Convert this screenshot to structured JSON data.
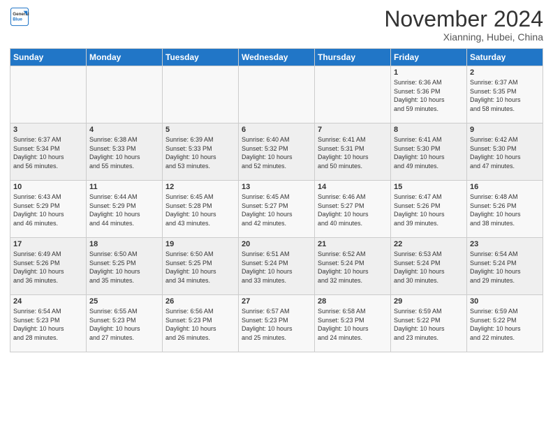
{
  "header": {
    "logo_line1": "General",
    "logo_line2": "Blue",
    "month_title": "November 2024",
    "location": "Xianning, Hubei, China"
  },
  "weekdays": [
    "Sunday",
    "Monday",
    "Tuesday",
    "Wednesday",
    "Thursday",
    "Friday",
    "Saturday"
  ],
  "weeks": [
    [
      {
        "day": "",
        "info": ""
      },
      {
        "day": "",
        "info": ""
      },
      {
        "day": "",
        "info": ""
      },
      {
        "day": "",
        "info": ""
      },
      {
        "day": "",
        "info": ""
      },
      {
        "day": "1",
        "info": "Sunrise: 6:36 AM\nSunset: 5:36 PM\nDaylight: 10 hours\nand 59 minutes."
      },
      {
        "day": "2",
        "info": "Sunrise: 6:37 AM\nSunset: 5:35 PM\nDaylight: 10 hours\nand 58 minutes."
      }
    ],
    [
      {
        "day": "3",
        "info": "Sunrise: 6:37 AM\nSunset: 5:34 PM\nDaylight: 10 hours\nand 56 minutes."
      },
      {
        "day": "4",
        "info": "Sunrise: 6:38 AM\nSunset: 5:33 PM\nDaylight: 10 hours\nand 55 minutes."
      },
      {
        "day": "5",
        "info": "Sunrise: 6:39 AM\nSunset: 5:33 PM\nDaylight: 10 hours\nand 53 minutes."
      },
      {
        "day": "6",
        "info": "Sunrise: 6:40 AM\nSunset: 5:32 PM\nDaylight: 10 hours\nand 52 minutes."
      },
      {
        "day": "7",
        "info": "Sunrise: 6:41 AM\nSunset: 5:31 PM\nDaylight: 10 hours\nand 50 minutes."
      },
      {
        "day": "8",
        "info": "Sunrise: 6:41 AM\nSunset: 5:30 PM\nDaylight: 10 hours\nand 49 minutes."
      },
      {
        "day": "9",
        "info": "Sunrise: 6:42 AM\nSunset: 5:30 PM\nDaylight: 10 hours\nand 47 minutes."
      }
    ],
    [
      {
        "day": "10",
        "info": "Sunrise: 6:43 AM\nSunset: 5:29 PM\nDaylight: 10 hours\nand 46 minutes."
      },
      {
        "day": "11",
        "info": "Sunrise: 6:44 AM\nSunset: 5:29 PM\nDaylight: 10 hours\nand 44 minutes."
      },
      {
        "day": "12",
        "info": "Sunrise: 6:45 AM\nSunset: 5:28 PM\nDaylight: 10 hours\nand 43 minutes."
      },
      {
        "day": "13",
        "info": "Sunrise: 6:45 AM\nSunset: 5:27 PM\nDaylight: 10 hours\nand 42 minutes."
      },
      {
        "day": "14",
        "info": "Sunrise: 6:46 AM\nSunset: 5:27 PM\nDaylight: 10 hours\nand 40 minutes."
      },
      {
        "day": "15",
        "info": "Sunrise: 6:47 AM\nSunset: 5:26 PM\nDaylight: 10 hours\nand 39 minutes."
      },
      {
        "day": "16",
        "info": "Sunrise: 6:48 AM\nSunset: 5:26 PM\nDaylight: 10 hours\nand 38 minutes."
      }
    ],
    [
      {
        "day": "17",
        "info": "Sunrise: 6:49 AM\nSunset: 5:26 PM\nDaylight: 10 hours\nand 36 minutes."
      },
      {
        "day": "18",
        "info": "Sunrise: 6:50 AM\nSunset: 5:25 PM\nDaylight: 10 hours\nand 35 minutes."
      },
      {
        "day": "19",
        "info": "Sunrise: 6:50 AM\nSunset: 5:25 PM\nDaylight: 10 hours\nand 34 minutes."
      },
      {
        "day": "20",
        "info": "Sunrise: 6:51 AM\nSunset: 5:24 PM\nDaylight: 10 hours\nand 33 minutes."
      },
      {
        "day": "21",
        "info": "Sunrise: 6:52 AM\nSunset: 5:24 PM\nDaylight: 10 hours\nand 32 minutes."
      },
      {
        "day": "22",
        "info": "Sunrise: 6:53 AM\nSunset: 5:24 PM\nDaylight: 10 hours\nand 30 minutes."
      },
      {
        "day": "23",
        "info": "Sunrise: 6:54 AM\nSunset: 5:24 PM\nDaylight: 10 hours\nand 29 minutes."
      }
    ],
    [
      {
        "day": "24",
        "info": "Sunrise: 6:54 AM\nSunset: 5:23 PM\nDaylight: 10 hours\nand 28 minutes."
      },
      {
        "day": "25",
        "info": "Sunrise: 6:55 AM\nSunset: 5:23 PM\nDaylight: 10 hours\nand 27 minutes."
      },
      {
        "day": "26",
        "info": "Sunrise: 6:56 AM\nSunset: 5:23 PM\nDaylight: 10 hours\nand 26 minutes."
      },
      {
        "day": "27",
        "info": "Sunrise: 6:57 AM\nSunset: 5:23 PM\nDaylight: 10 hours\nand 25 minutes."
      },
      {
        "day": "28",
        "info": "Sunrise: 6:58 AM\nSunset: 5:23 PM\nDaylight: 10 hours\nand 24 minutes."
      },
      {
        "day": "29",
        "info": "Sunrise: 6:59 AM\nSunset: 5:22 PM\nDaylight: 10 hours\nand 23 minutes."
      },
      {
        "day": "30",
        "info": "Sunrise: 6:59 AM\nSunset: 5:22 PM\nDaylight: 10 hours\nand 22 minutes."
      }
    ]
  ]
}
